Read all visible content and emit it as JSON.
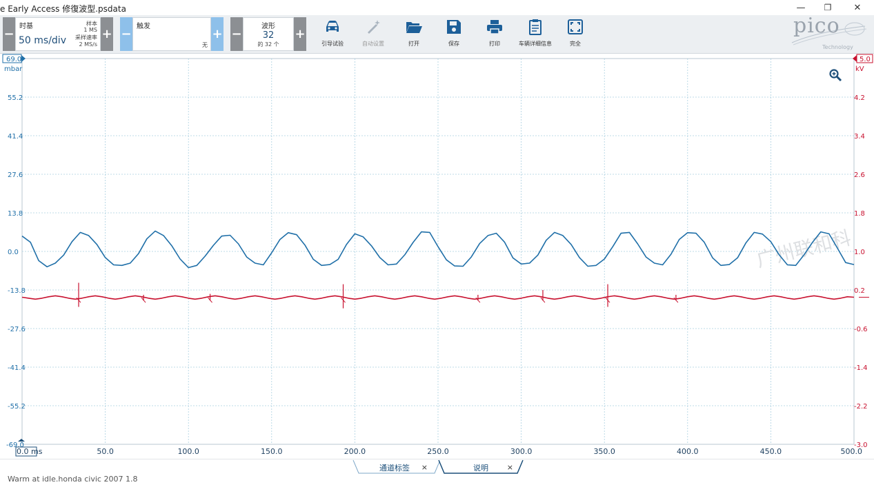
{
  "window": {
    "title": "e Early Access 修復波型.psdata",
    "controls": {
      "minimize": "—",
      "restore": "❐",
      "close": "✕"
    }
  },
  "toolbar": {
    "timebase": {
      "label": "时基",
      "value": "50 ms/div",
      "samples_label": "样本",
      "samples_value": "1 MS",
      "rate_label": "采样速率",
      "rate_value": "2 MS/s",
      "minus": "−",
      "plus": "+"
    },
    "trigger": {
      "label": "触发",
      "mode": "无",
      "minus": "−",
      "plus": "+"
    },
    "waveform": {
      "label": "波形",
      "value": "32",
      "of_text": "的 32 个",
      "minus": "−",
      "plus": "+"
    },
    "buttons": [
      {
        "label": "引导试验",
        "icon": "car-icon"
      },
      {
        "label": "自动设置",
        "icon": "magic-wand-icon"
      },
      {
        "label": "打开",
        "icon": "folder-open-icon"
      },
      {
        "label": "保存",
        "icon": "save-icon"
      },
      {
        "label": "打印",
        "icon": "printer-icon"
      },
      {
        "label": "车辆详细信息",
        "icon": "clipboard-icon"
      },
      {
        "label": "完全",
        "icon": "fullscreen-icon"
      }
    ],
    "logo": {
      "text": "pico",
      "sub": "Technology"
    }
  },
  "watermark": "广州联和科",
  "tabs": [
    {
      "label": "通道标签",
      "close": "×"
    },
    {
      "label": "说明",
      "close": "×"
    }
  ],
  "status_text": "Warm at idle.honda civic 2007 1.8",
  "chart_data": {
    "type": "line",
    "x": {
      "unit": "ms",
      "range": [
        0,
        500
      ],
      "ticks": [
        0,
        50,
        100,
        150,
        200,
        250,
        300,
        350,
        400,
        450,
        500
      ],
      "tick_labels": [
        "0.0 ms",
        "50.0",
        "100.0",
        "150.0",
        "200.0",
        "250.0",
        "300.0",
        "350.0",
        "400.0",
        "450.0",
        "500.0"
      ]
    },
    "y_left": {
      "unit": "mbar",
      "range": [
        -69.0,
        69.0
      ],
      "top_marker": "69.0",
      "bottom_marker": "-69.0",
      "ticks": [
        55.2,
        41.4,
        27.6,
        13.8,
        0.0,
        -13.8,
        -27.6,
        -41.4,
        -55.2
      ],
      "tick_labels": [
        "55.2",
        "41.4",
        "27.6",
        "13.8",
        "0.0",
        "-13.8",
        "-27.6",
        "-41.4",
        "-55.2"
      ]
    },
    "y_right": {
      "unit": "kV",
      "range": [
        -3.0,
        5.0
      ],
      "top_marker": "5.0",
      "bottom_marker": "-3.0",
      "ticks": [
        4.2,
        3.4,
        2.6,
        1.8,
        1.0,
        0.2,
        -0.6,
        -1.4,
        -2.2
      ],
      "tick_labels": [
        "4.2",
        "3.4",
        "2.6",
        "1.8",
        "1.0",
        "0.2",
        "-0.6",
        "-1.4",
        "-2.2"
      ]
    },
    "grid": true,
    "series": [
      {
        "axis": "left",
        "color": "#1f6fa8",
        "x": [
          0,
          5,
          10,
          15,
          20,
          25,
          30,
          35,
          40,
          45,
          50,
          55,
          60,
          65,
          70,
          75,
          80,
          85,
          90,
          95,
          100,
          105,
          110,
          115,
          120,
          125,
          130,
          135,
          140,
          145,
          150,
          155,
          160,
          165,
          170,
          175,
          180,
          185,
          190,
          195,
          200,
          205,
          210,
          215,
          220,
          225,
          230,
          235,
          240,
          245,
          250,
          255,
          260,
          265,
          270,
          275,
          280,
          285,
          290,
          295,
          300,
          305,
          310,
          315,
          320,
          325,
          330,
          335,
          340,
          345,
          350,
          355,
          360,
          365,
          370,
          375,
          380,
          385,
          390,
          395,
          400,
          405,
          410,
          415,
          420,
          425,
          430,
          435,
          440,
          445,
          450,
          455,
          460,
          465,
          470,
          475,
          480,
          485,
          490,
          495,
          500
        ],
        "y": [
          5.5,
          3,
          -3,
          -5.5,
          -4.5,
          -1,
          3.5,
          6.5,
          6,
          2.5,
          -2.5,
          -4.5,
          -5,
          -4.5,
          -0.5,
          4.5,
          7,
          6,
          2,
          -3,
          -5.5,
          -5,
          -2,
          2.5,
          5.5,
          5.5,
          3,
          -2,
          -4.5,
          -4.5,
          -0.5,
          4,
          7,
          6,
          2,
          -2.5,
          -5,
          -5,
          -2.5,
          2.5,
          6,
          5.5,
          2,
          -2.5,
          -4.5,
          -4.5,
          -1.5,
          3.5,
          7,
          6.5,
          2,
          -3,
          -5.5,
          -5,
          -2,
          2.5,
          6,
          6.5,
          3,
          -2,
          -4.5,
          -4.5,
          -1,
          4,
          6.5,
          6,
          2.5,
          -2.5,
          -5,
          -5,
          -3,
          2,
          6.5,
          6.5,
          3,
          -2,
          -4.5,
          -4.5,
          -1,
          4,
          7,
          6.5,
          3,
          -2,
          -5,
          -5,
          -2,
          3,
          6.5,
          6.5,
          3.5,
          -1.5,
          -4.5,
          -5,
          -1.5,
          3.5,
          7,
          6,
          1.5,
          -4,
          -5
        ]
      },
      {
        "axis": "right",
        "color": "#c8102e",
        "x": [
          0,
          4,
          8,
          12,
          16,
          20,
          24,
          28,
          32,
          36,
          40,
          44,
          48,
          52,
          56,
          60,
          64,
          68,
          72,
          76,
          80,
          84,
          88,
          92,
          96,
          100,
          104,
          108,
          112,
          116,
          120,
          124,
          128,
          132,
          136,
          140,
          144,
          148,
          152,
          156,
          160,
          164,
          168,
          172,
          176,
          180,
          184,
          188,
          192,
          196,
          200,
          204,
          208,
          212,
          216,
          220,
          224,
          228,
          232,
          236,
          240,
          244,
          248,
          252,
          256,
          260,
          264,
          268,
          272,
          276,
          280,
          284,
          288,
          292,
          296,
          300,
          304,
          308,
          312,
          316,
          320,
          324,
          328,
          332,
          336,
          340,
          344,
          348,
          352,
          356,
          360,
          364,
          368,
          372,
          376,
          380,
          384,
          388,
          392,
          396,
          400,
          404,
          408,
          412,
          416,
          420,
          424,
          428,
          432,
          436,
          440,
          444,
          448,
          452,
          456,
          460,
          464,
          468,
          472,
          476,
          480,
          484,
          488,
          492,
          496,
          500
        ],
        "y": [
          0.05,
          0.03,
          0.01,
          0.03,
          0.06,
          0.08,
          0.06,
          0.03,
          0.01,
          0.03,
          0.06,
          0.08,
          0.06,
          0.03,
          0.01,
          0.03,
          0.06,
          0.08,
          0.06,
          0.03,
          0.01,
          0.03,
          0.06,
          0.08,
          0.06,
          0.03,
          0.01,
          0.03,
          0.06,
          0.08,
          0.06,
          0.03,
          0.01,
          0.03,
          0.06,
          0.08,
          0.06,
          0.03,
          0.01,
          0.03,
          0.06,
          0.08,
          0.06,
          0.03,
          0.01,
          0.03,
          0.06,
          0.08,
          0.06,
          0.03,
          0.01,
          0.03,
          0.06,
          0.08,
          0.06,
          0.03,
          0.01,
          0.03,
          0.06,
          0.08,
          0.06,
          0.03,
          0.01,
          0.03,
          0.06,
          0.08,
          0.06,
          0.03,
          0.01,
          0.03,
          0.06,
          0.08,
          0.06,
          0.03,
          0.01,
          0.03,
          0.06,
          0.08,
          0.06,
          0.03,
          0.01,
          0.03,
          0.06,
          0.08,
          0.06,
          0.03,
          0.01,
          0.03,
          0.06,
          0.08,
          0.06,
          0.03,
          0.01,
          0.03,
          0.06,
          0.08,
          0.06,
          0.03,
          0.01,
          0.03,
          0.06,
          0.08,
          0.06,
          0.03,
          0.01,
          0.03,
          0.06,
          0.08,
          0.06,
          0.03,
          0.01,
          0.03,
          0.06,
          0.08,
          0.06,
          0.03,
          0.01,
          0.03,
          0.06,
          0.08,
          0.06,
          0.03,
          0.01,
          0.03,
          0.06,
          0.05
        ],
        "spikes": [
          {
            "x": 34,
            "high": 0.35,
            "low": -0.15
          },
          {
            "x": 73,
            "high": 0.1,
            "low": -0.02
          },
          {
            "x": 113,
            "high": 0.12,
            "low": -0.02
          },
          {
            "x": 193,
            "high": 0.32,
            "low": -0.18
          },
          {
            "x": 274,
            "high": 0.1,
            "low": -0.02
          },
          {
            "x": 313,
            "high": 0.2,
            "low": -0.02
          },
          {
            "x": 352,
            "high": 0.32,
            "low": -0.15
          },
          {
            "x": 393,
            "high": 0.1,
            "low": -0.02
          }
        ]
      }
    ]
  }
}
